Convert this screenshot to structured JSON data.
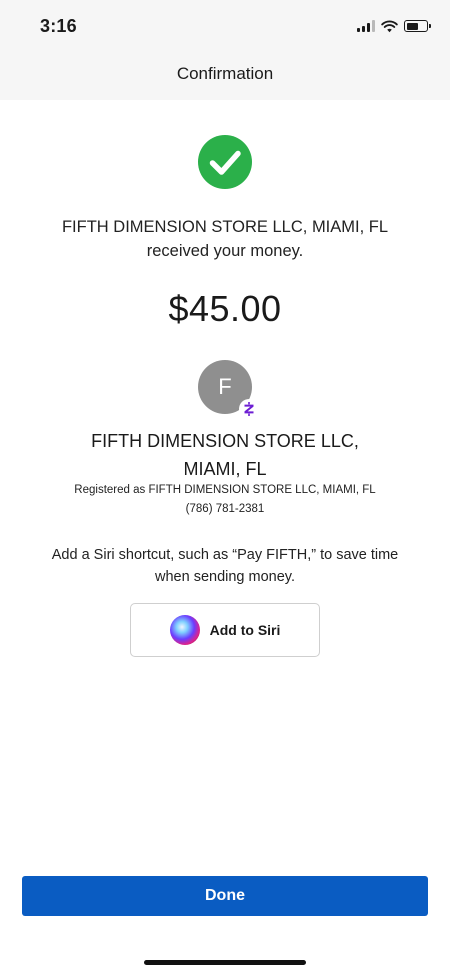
{
  "status_bar": {
    "time": "3:16",
    "icons": [
      "cellular-signal-icon",
      "wifi-icon",
      "battery-icon"
    ]
  },
  "header": {
    "title": "Confirmation"
  },
  "confirmation": {
    "icon": "check-circle-icon",
    "icon_color": "#2bb04a",
    "message_line1": "FIFTH DIMENSION STORE LLC, MIAMI, FL",
    "message_line2": "received your money.",
    "amount": "$45.00"
  },
  "recipient": {
    "avatar_initial": "F",
    "avatar_color": "#8f8f8f",
    "badge_icon": "zelle-icon",
    "badge_color": "#6d1ed4",
    "name_line1": "FIFTH DIMENSION STORE LLC,",
    "name_line2": "MIAMI, FL",
    "registered": "Registered as FIFTH DIMENSION STORE LLC, MIAMI, FL",
    "phone": "(786) 781-2381"
  },
  "siri": {
    "prompt_line1": "Add a Siri shortcut, such as “Pay FIFTH,” to save time",
    "prompt_line2": "when sending money.",
    "button_label": "Add to Siri",
    "icon": "siri-icon"
  },
  "footer": {
    "done_label": "Done",
    "done_color": "#0a5cc2"
  }
}
